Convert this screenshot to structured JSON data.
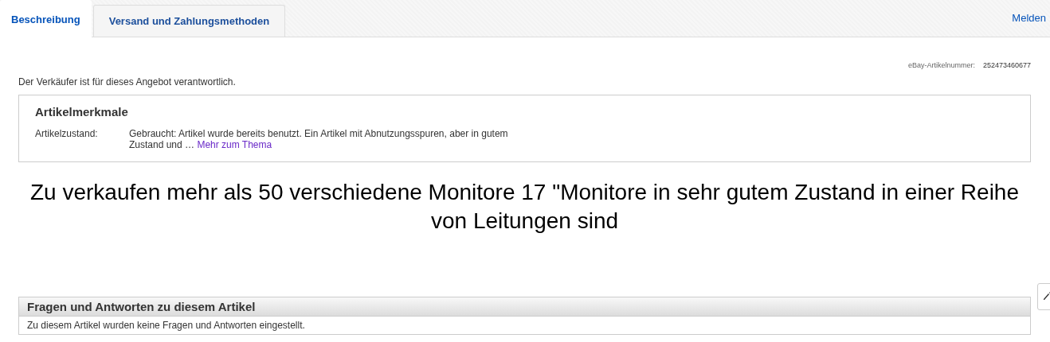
{
  "tabs": [
    {
      "label": "Beschreibung",
      "selected": true
    },
    {
      "label": "Versand und Zahlungsmethoden",
      "selected": false
    }
  ],
  "report_link": "Melden",
  "item_number": {
    "label": "eBay-Artikelnummer:",
    "value": "252473460677"
  },
  "responsibility_note": "Der Verkäufer ist für dieses Angebot verantwortlich.",
  "item_specifics": {
    "title": "Artikelmerkmale",
    "rows": [
      {
        "label": "Artikelzustand:",
        "value": "Gebraucht: Artikel wurde bereits benutzt. Ein Artikel mit Abnutzungsspuren, aber in gutem Zustand und …",
        "link": "Mehr zum Thema"
      }
    ]
  },
  "description": "Zu verkaufen mehr als 50 verschiedene Monitore 17 \"Monitore in sehr gutem Zustand in einer Reihe von Leitungen sind",
  "questions": {
    "title": "Fragen und Antworten zu diesem Artikel",
    "message": "Zu diesem Artikel wurden keine Fragen und Antworten eingestellt."
  }
}
